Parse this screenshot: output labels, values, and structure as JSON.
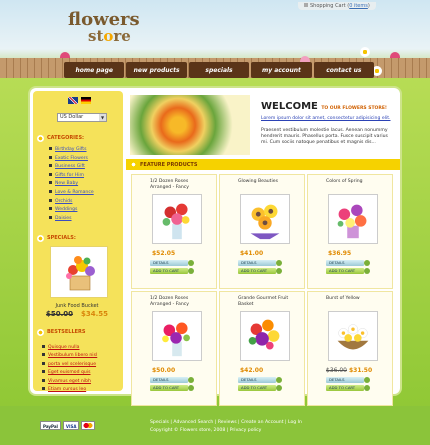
{
  "brand": {
    "line1": "flowers",
    "line2_a": "st",
    "line2_o": "o",
    "line2_b": "re"
  },
  "cart": {
    "label": "Shopping Cart (",
    "link": "0 items",
    "close": ")"
  },
  "nav": [
    "home page",
    "new products",
    "specials",
    "my account",
    "contact us"
  ],
  "currency": {
    "selected": "US Dollar"
  },
  "sidebar": {
    "categories_title": "CATEGORIES:",
    "categories": [
      "Birthday Gifts",
      "Exotic Flowers",
      "Business Gift",
      "Gifts for Him",
      "New Baby",
      "Love & Romance",
      "Orchids",
      "Weddings",
      "Daisies"
    ],
    "specials_title": "SPECIALS:",
    "special": {
      "name": "Junk Food Bucket",
      "old_price": "$50.00",
      "price": "$34.55"
    },
    "bestsellers_title": "BESTSELLERS",
    "bestsellers": [
      "Quisque nulla",
      "Vestibulum libero nisl",
      "porta vel scelerisque",
      "Eget euismod quis",
      "Vivamus eget nibh",
      "Etiam cursus leo"
    ]
  },
  "welcome": {
    "title": "WELCOME",
    "title_small": "TO OUR FLOWERS STORE!",
    "link": "Lorem ipsum dolor sit amet, consectetur adipisicing elit.",
    "text": "Praesent vestibulum molestie lacus. Aenean nonummy hendrerit mauris. Phasellus porta. Fusce suscipit varius mi. Cum sociis natoque penatibus et magnis dis..."
  },
  "featured": {
    "title": "FEATURE PRODUCTS",
    "details_label": "DETAILS",
    "add_label": "ADD TO CART",
    "products": [
      {
        "name": "1/2 Dozen Roses Arranged - Fancy",
        "old_price": "",
        "price": "$52.05"
      },
      {
        "name": "Glowing Beauties",
        "old_price": "",
        "price": "$41.00"
      },
      {
        "name": "Colors of Spring",
        "old_price": "",
        "price": "$36.95"
      },
      {
        "name": "1/2 Dozen Roses Arranged - Fancy",
        "old_price": "",
        "price": "$50.00"
      },
      {
        "name": "Grande Gourmet Fruit Basket",
        "old_price": "",
        "price": "$42.00"
      },
      {
        "name": "Burst of Yellow",
        "old_price": "$36.00",
        "price": "$31.50"
      }
    ]
  },
  "footer": {
    "links": "Specials  |  Advanced Search  |  Reviews  |  Create an Account  |  Log In",
    "copyright": "Copyright © Flowers store, 2008  |  Privacy policy",
    "payments": [
      "PayPal",
      "VISA",
      ""
    ]
  },
  "colors": {
    "accent": "#f6d200",
    "nav": "#5a3418",
    "price": "#e08a00",
    "link": "#3b4ec0",
    "grass": "#9ccd3d"
  }
}
